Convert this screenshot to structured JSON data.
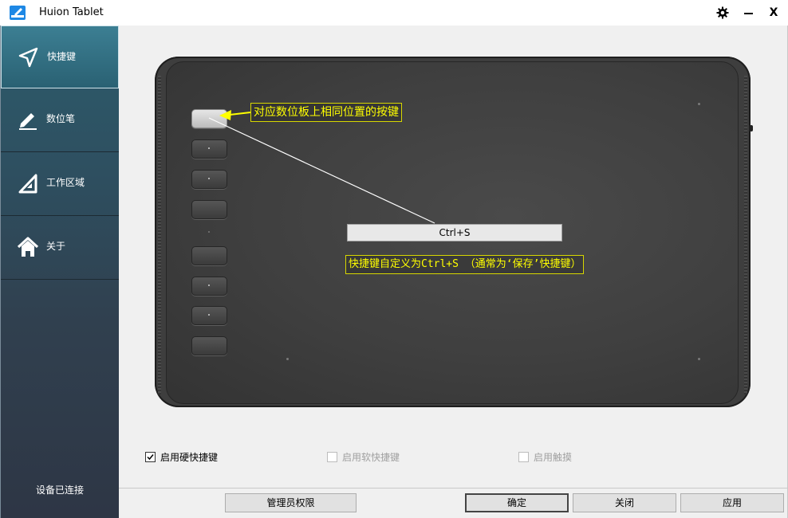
{
  "window": {
    "title": "Huion Tablet",
    "settings_icon": "gear-icon",
    "minimize_icon": "minimize-icon",
    "close_icon": "close-icon",
    "minimize_glyph": "—",
    "close_glyph": "X"
  },
  "sidebar": {
    "items": [
      {
        "label": "快捷键",
        "icon": "shortcut-arrow-icon",
        "active": true
      },
      {
        "label": "数位笔",
        "icon": "pen-icon",
        "active": false
      },
      {
        "label": "工作区域",
        "icon": "ruler-triangle-icon",
        "active": false
      },
      {
        "label": "关于",
        "icon": "home-icon",
        "active": false
      }
    ],
    "status": "设备已连接"
  },
  "tablet": {
    "callout_button": "对应数位板上相同位置的按键",
    "shortcut_value": "Ctrl+S",
    "callout_shortcut": "快捷键自定义为Ctrl+S （通常为‘保存’快捷键）",
    "selected_key_index": 0
  },
  "options": {
    "hardware_shortcuts": {
      "label": "启用硬快捷键",
      "checked": true,
      "enabled": true
    },
    "software_shortcuts": {
      "label": "启用软快捷键",
      "checked": false,
      "enabled": false
    },
    "touch": {
      "label": "启用触摸",
      "checked": false,
      "enabled": false
    }
  },
  "buttons": {
    "admin": "管理员权限",
    "ok": "确定",
    "close": "关闭",
    "apply": "应用"
  },
  "colors": {
    "sidebar_top": "#2c5c6c",
    "sidebar_bottom": "#2e3645",
    "callout": "#ffff00",
    "tablet_body": "#3e3e3e"
  }
}
